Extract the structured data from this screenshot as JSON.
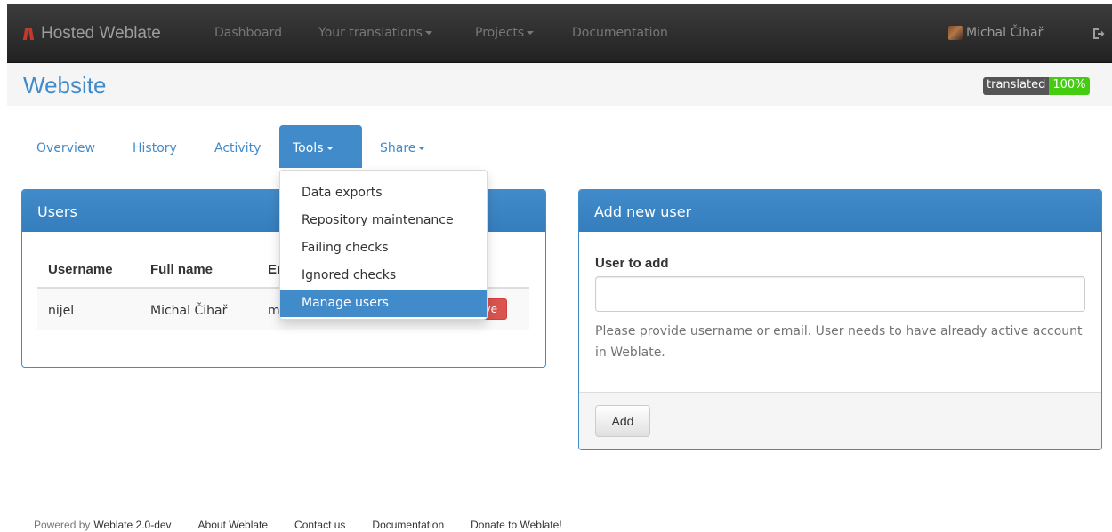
{
  "navbar": {
    "brand": "Hosted Weblate",
    "links": [
      "Dashboard",
      "Your translations",
      "Projects",
      "Documentation"
    ],
    "user_name": "Michal Čihař"
  },
  "header": {
    "title": "Website",
    "badge_label": "translated",
    "badge_value": "100%"
  },
  "tabs": [
    "Overview",
    "History",
    "Activity",
    "Tools",
    "Share"
  ],
  "tools_menu": [
    "Data exports",
    "Repository maintenance",
    "Failing checks",
    "Ignored checks",
    "Manage users"
  ],
  "users_panel": {
    "title": "Users",
    "columns": [
      "Username",
      "Full name",
      "Er"
    ],
    "rows": [
      {
        "username": "nijel",
        "full_name": "Michal Čihař",
        "email_partial": "m",
        "remove_partial": "ve"
      }
    ]
  },
  "add_user_panel": {
    "title": "Add new user",
    "field_label": "User to add",
    "input_value": "",
    "help_text": "Please provide username or email. User needs to have already active account in Weblate.",
    "button_label": "Add"
  },
  "footer": {
    "powered_prefix": "Powered by",
    "powered_link": "Weblate 2.0-dev",
    "links": [
      "About Weblate",
      "Contact us",
      "Documentation",
      "Donate to Weblate!"
    ]
  },
  "colors": {
    "primary": "#428bca",
    "danger": "#d9534f",
    "badge_success": "#44cc11"
  },
  "icons": [
    "weblate-logo-icon",
    "avatar",
    "logout-icon",
    "caret-down-icon"
  ]
}
